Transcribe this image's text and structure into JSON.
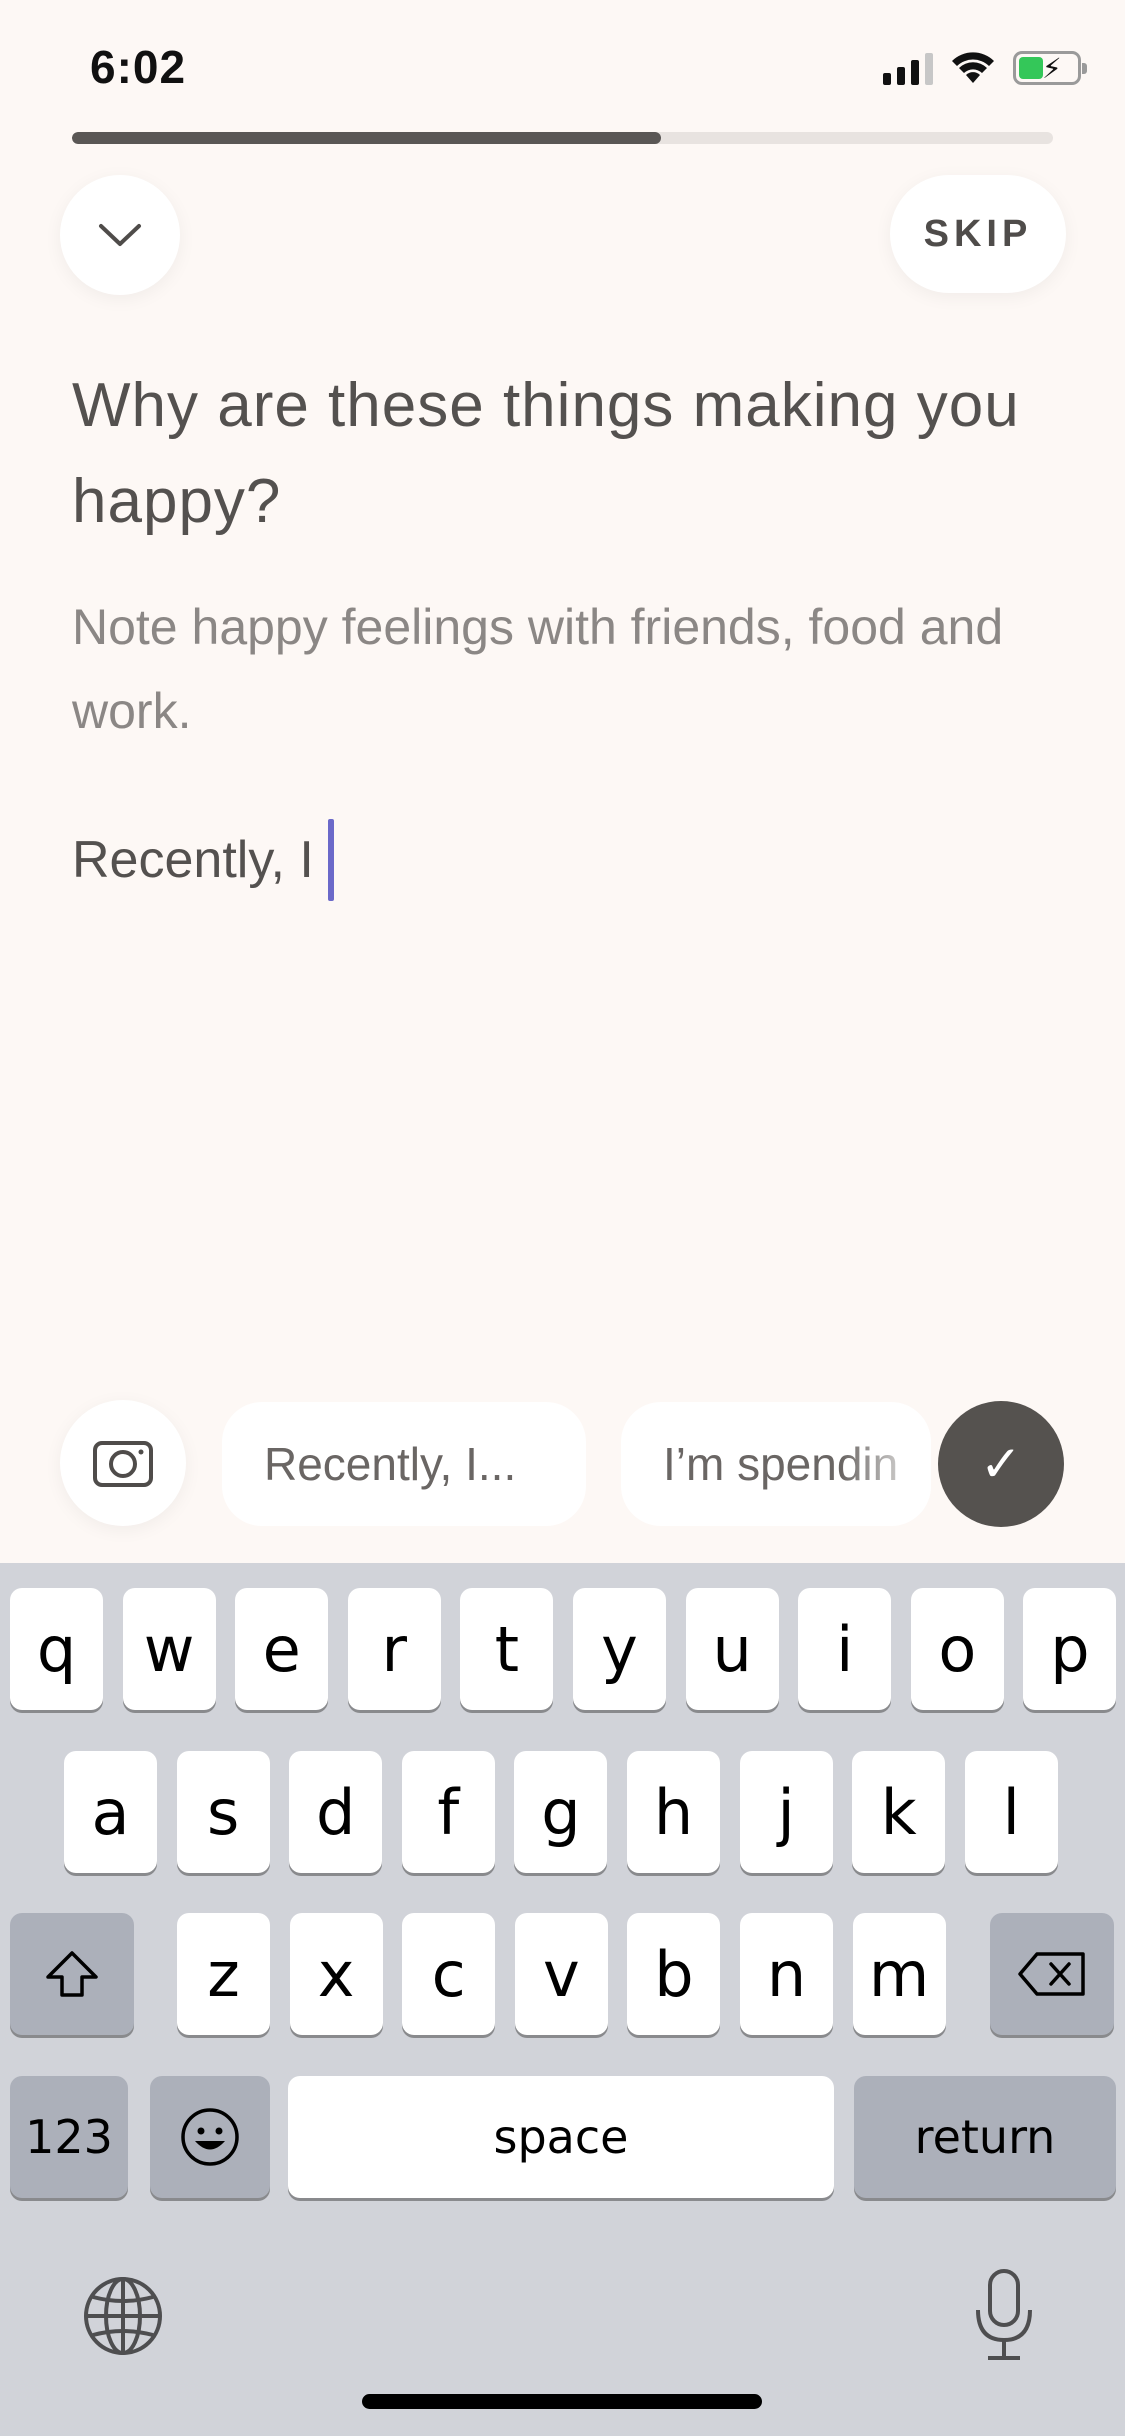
{
  "status_bar": {
    "time": "6:02"
  },
  "progress": {
    "fraction": 0.6
  },
  "header": {
    "skip_label": "SKIP"
  },
  "prompt": {
    "question": "Why are these things making you happy?",
    "hint": "Note happy feelings with friends, food and work.",
    "entry_text": "Recently, I"
  },
  "suggestions": [
    "Recently, I...",
    "I’m spendin"
  ],
  "keyboard": {
    "row1": [
      "q",
      "w",
      "e",
      "r",
      "t",
      "y",
      "u",
      "i",
      "o",
      "p"
    ],
    "row2": [
      "a",
      "s",
      "d",
      "f",
      "g",
      "h",
      "j",
      "k",
      "l"
    ],
    "row3": [
      "z",
      "x",
      "c",
      "v",
      "b",
      "n",
      "m"
    ],
    "numbers_label": "123",
    "space_label": "space",
    "return_label": "return"
  },
  "colors": {
    "background": "#fdf8f5",
    "accent_caret": "#6b69c9",
    "done_button": "#55524f"
  }
}
